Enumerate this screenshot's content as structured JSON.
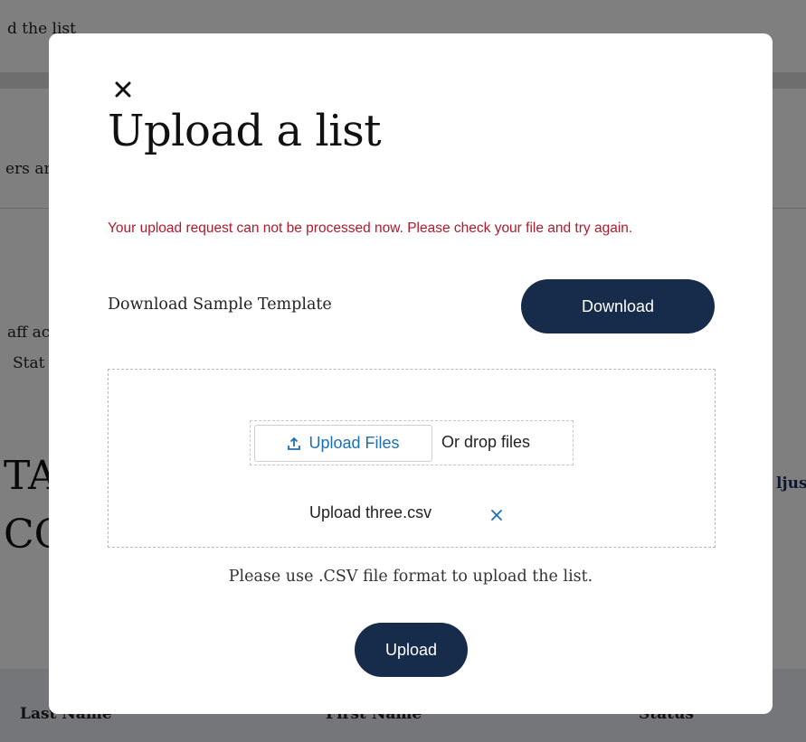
{
  "background": {
    "text_top": "d the list",
    "text_members": "ers ar",
    "text_staff": "aff ac",
    "text_stat": "Stat",
    "big_line1": "TA",
    "big_line2": "CO",
    "right_link": "ljus",
    "table_headers": [
      "Last Name",
      "First Name",
      "Status"
    ]
  },
  "modal": {
    "close_icon": "close-icon",
    "title": "Upload a list",
    "error_message": "Your upload request can not be processed now. Please check your file and try again.",
    "sample_label": "Download Sample Template",
    "download_label": "Download",
    "upload_files_label": "Upload Files",
    "upload_files_icon": "upload-icon",
    "drop_text": "Or drop files",
    "file_name": "Upload three.csv",
    "remove_file_icon": "close-icon",
    "hint": "Please use .CSV file format to upload the list.",
    "upload_label": "Upload"
  },
  "colors": {
    "primary": "#162c4a",
    "error": "#b3192a",
    "link": "#1f6fb0"
  }
}
